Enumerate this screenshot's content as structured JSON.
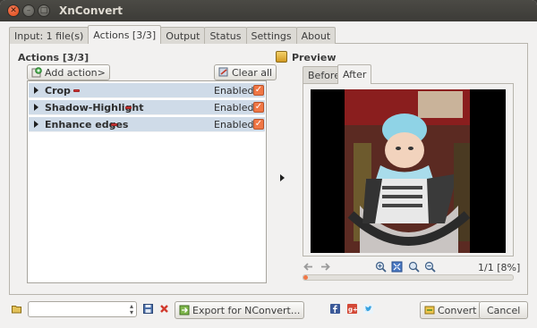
{
  "window": {
    "title": "XnConvert"
  },
  "tabs": [
    {
      "label": "Input: 1 file(s)"
    },
    {
      "label": "Actions [3/3]",
      "active": true
    },
    {
      "label": "Output"
    },
    {
      "label": "Status"
    },
    {
      "label": "Settings"
    },
    {
      "label": "About"
    }
  ],
  "actions": {
    "title": "Actions [3/3]",
    "add_label": "Add action>",
    "clear_label": "Clear all",
    "items": [
      {
        "name": "Crop",
        "status": "Enabled",
        "checked": true
      },
      {
        "name": "Shadow-Highlight",
        "status": "Enabled",
        "checked": true
      },
      {
        "name": "Enhance edges",
        "status": "Enabled",
        "checked": true
      }
    ]
  },
  "preview": {
    "title": "Preview",
    "tabs": [
      {
        "label": "Before"
      },
      {
        "label": "After",
        "active": true
      }
    ],
    "page_info": "1/1 [8%]",
    "progress_fraction": 0.02
  },
  "bottom": {
    "export_label": "Export for NConvert...",
    "convert_label": "Convert",
    "cancel_label": "Cancel",
    "preset_value": ""
  },
  "colors": {
    "accent": "#f07746",
    "row_bg": "#cfdbe8",
    "titlebar": "#3c3b37"
  }
}
